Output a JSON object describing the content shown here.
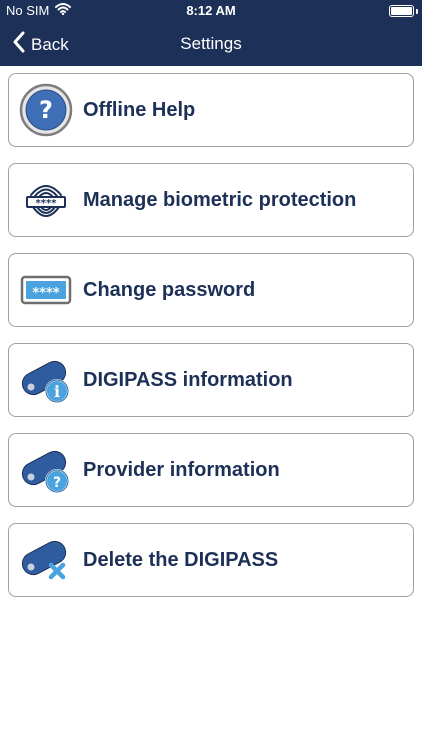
{
  "status": {
    "carrier": "No SIM",
    "time": "8:12 AM",
    "battery_level": 1.0
  },
  "nav": {
    "back_label": "Back",
    "title": "Settings"
  },
  "menu": [
    {
      "label": "Offline Help",
      "icon": "help-icon"
    },
    {
      "label": "Manage biometric protection",
      "icon": "fingerprint-icon"
    },
    {
      "label": "Change password",
      "icon": "password-icon"
    },
    {
      "label": "DIGIPASS information",
      "icon": "digipass-info-icon"
    },
    {
      "label": "Provider information",
      "icon": "provider-info-icon"
    },
    {
      "label": "Delete the DIGIPASS",
      "icon": "digipass-delete-icon"
    }
  ],
  "colors": {
    "navbar": "#1d3057",
    "label": "#1d3057",
    "border": "#9aa0a6",
    "accent": "#4aa3df"
  }
}
